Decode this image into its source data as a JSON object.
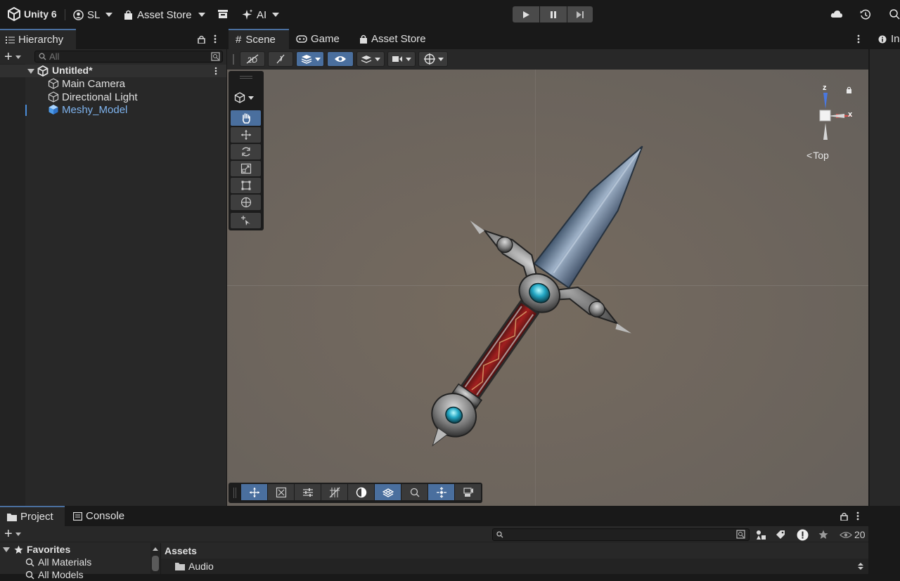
{
  "topbar": {
    "app_label": "Unity 6",
    "account_label": "SL",
    "asset_store_label": "Asset Store",
    "ai_label": "AI"
  },
  "hierarchy": {
    "tab_label": "Hierarchy",
    "search_placeholder": "All",
    "scene_name": "Untitled*",
    "items": [
      {
        "label": "Main Camera"
      },
      {
        "label": "Directional Light"
      },
      {
        "label": "Meshy_Model"
      }
    ]
  },
  "scene_tabs": {
    "scene": "Scene",
    "game": "Game",
    "asset_store": "Asset Store",
    "inspector_partial": "Ins"
  },
  "gizmo": {
    "z_label": "z",
    "x_label": "x",
    "view_label": "Top"
  },
  "bottom": {
    "project_tab": "Project",
    "console_tab": "Console",
    "favorites_label": "Favorites",
    "favorites_items": [
      "All Materials",
      "All Models"
    ],
    "assets_header": "Assets",
    "asset_items": [
      "Audio"
    ],
    "visible_count": "20"
  },
  "colors": {
    "accent": "#4a6f9e",
    "selected_text": "#7fb4ef",
    "scene_bg": "#6d655d",
    "gizmo_x": "#d9534f",
    "gizmo_z": "#4a78e0"
  }
}
